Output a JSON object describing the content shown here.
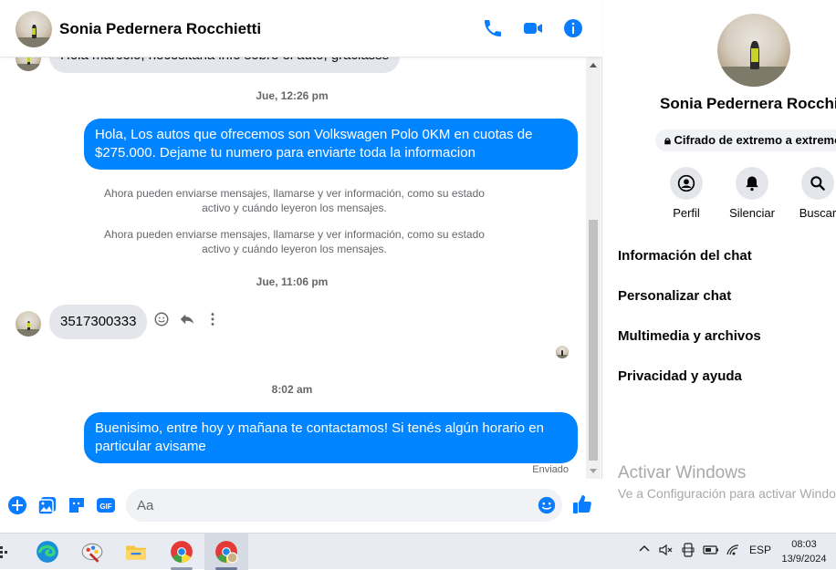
{
  "header": {
    "contact_name": "Sonia Pedernera Rocchietti"
  },
  "messages": {
    "top_partial": "Hola marcelo, necesitaria info sobre el auto, graciasss",
    "ts1": "Jue, 12:26 pm",
    "out1": "Hola, Los autos que ofrecemos son Volkswagen Polo 0KM en cuotas de $275.000. Dejame tu numero para enviarte toda la informacion",
    "sys1": "Ahora pueden enviarse mensajes, llamarse y ver información, como su estado activo y cuándo leyeron los mensajes.",
    "sys2": "Ahora pueden enviarse mensajes, llamarse y ver información, como su estado activo y cuándo leyeron los mensajes.",
    "ts2": "Jue, 11:06 pm",
    "in1": "3517300333",
    "ts3": "8:02 am",
    "out2": "Buenisimo, entre hoy y mañana te contactamos! Si tenés algún horario en particular avisame",
    "status": "Enviado"
  },
  "composer": {
    "placeholder": "Aa"
  },
  "panel": {
    "name": "Sonia Pedernera Rocchietti",
    "encryption": "Cifrado de extremo a extremo",
    "actions": {
      "profile": "Perfil",
      "mute": "Silenciar",
      "search": "Buscar"
    },
    "menu": {
      "chat_info": "Información del chat",
      "customize": "Personalizar chat",
      "media": "Multimedia y archivos",
      "privacy": "Privacidad y ayuda"
    },
    "watermark_title": "Activar Windows",
    "watermark_sub": "Ve a Configuración para activar Windows."
  },
  "taskbar": {
    "lang": "ESP",
    "time": "08:03",
    "date": "13/9/2024"
  },
  "colors": {
    "accent": "#0084ff",
    "outgoing_bubble": "#0084ff",
    "incoming_bubble": "#e4e6eb"
  }
}
